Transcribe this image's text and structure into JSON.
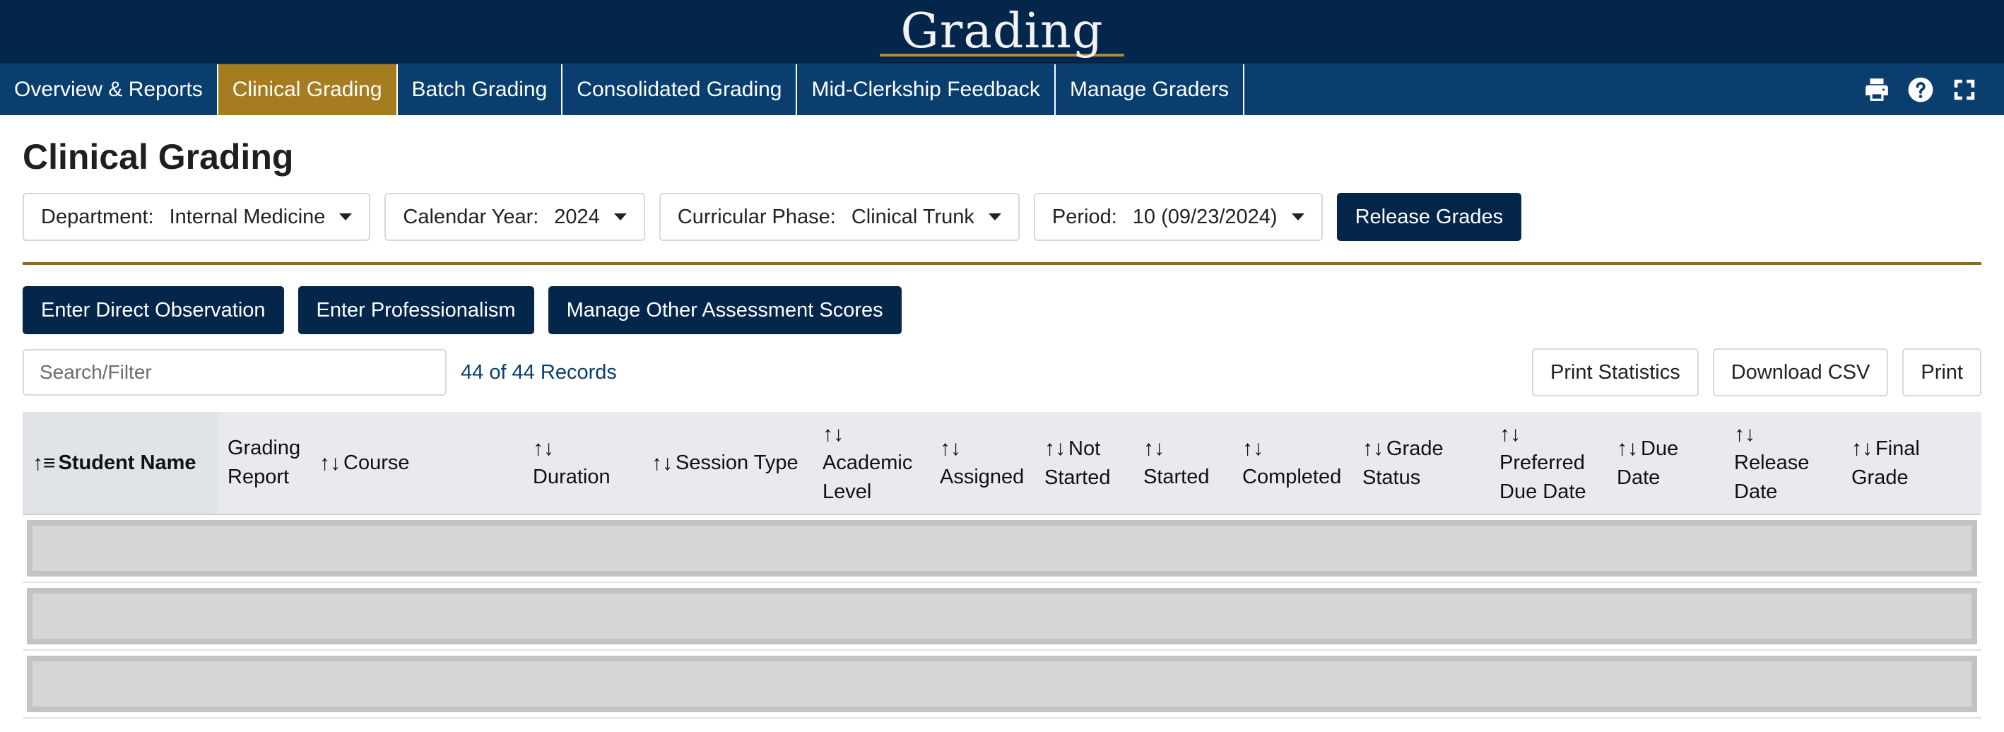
{
  "header": {
    "title": "Grading"
  },
  "nav": {
    "items": [
      {
        "label": "Overview & Reports",
        "active": false
      },
      {
        "label": "Clinical Grading",
        "active": true
      },
      {
        "label": "Batch Grading",
        "active": false
      },
      {
        "label": "Consolidated Grading",
        "active": false
      },
      {
        "label": "Mid-Clerkship Feedback",
        "active": false
      },
      {
        "label": "Manage Graders",
        "active": false
      }
    ],
    "icons": [
      "printer-icon",
      "help-icon",
      "fullscreen-icon"
    ]
  },
  "page": {
    "title": "Clinical Grading"
  },
  "filters": {
    "department": {
      "label": "Department:",
      "value": "Internal Medicine"
    },
    "calendar_year": {
      "label": "Calendar Year:",
      "value": "2024"
    },
    "curricular_phase": {
      "label": "Curricular Phase:",
      "value": "Clinical Trunk"
    },
    "period": {
      "label": "Period:",
      "value": "10 (09/23/2024)"
    },
    "release_label": "Release Grades"
  },
  "actions": {
    "direct_observation": "Enter Direct Observation",
    "professionalism": "Enter Professionalism",
    "other_scores": "Manage Other Assessment Scores"
  },
  "toolbar": {
    "search_placeholder": "Search/Filter",
    "records": "44 of 44 Records",
    "print_statistics": "Print Statistics",
    "download_csv": "Download CSV",
    "print": "Print"
  },
  "table": {
    "columns": {
      "student_name": "Student Name",
      "grading_report_1": "Grading",
      "grading_report_2": "Report",
      "course": "Course",
      "duration": "Duration",
      "session_type": "Session Type",
      "academic_level_1": "Academic",
      "academic_level_2": "Level",
      "assigned": "Assigned",
      "not_started_1": "Not",
      "not_started_2": "Started",
      "started": "Started",
      "completed": "Completed",
      "grade_status_1": "Grade",
      "grade_status_2": "Status",
      "preferred_due_date_1": "Preferred",
      "preferred_due_date_2": "Due Date",
      "due_date_1": "Due",
      "due_date_2": "Date",
      "release_date_1": "Release",
      "release_date_2": "Date",
      "final_grade_1": "Final",
      "final_grade_2": "Grade"
    },
    "sort_asc_icon": "↑≡",
    "sort_icon": "↑↓",
    "loading_rows": 3
  },
  "colors": {
    "banner": "#03264a",
    "navbar": "#0a3e6e",
    "nav_active": "#a67c20",
    "divider": "#8b6a28",
    "dark_button": "#03264a"
  }
}
